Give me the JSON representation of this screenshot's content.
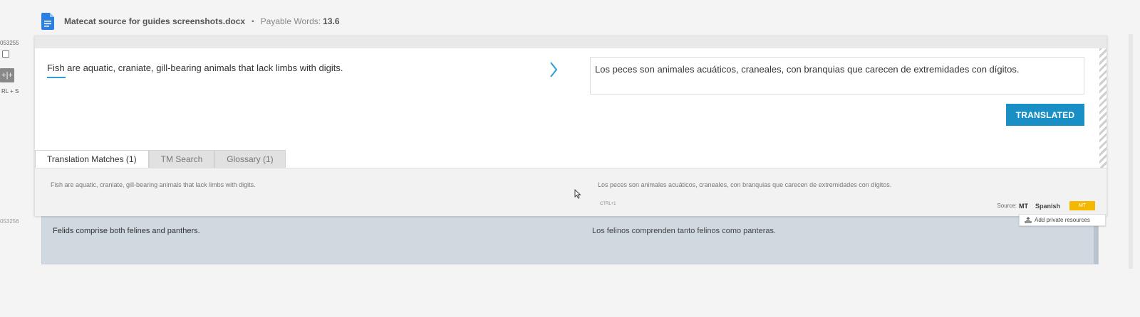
{
  "header": {
    "file_name": "Matecat source for guides screenshots.docx",
    "separator": "▪",
    "payable_label": "Payable Words:",
    "payable_value": "13.6"
  },
  "segments": {
    "active": {
      "id": "053255",
      "shortcut": "RL + S",
      "split_label": "+|+",
      "source": "Fish are aquatic, craniate, gill-bearing animals that lack limbs with digits.",
      "target": "Los peces son animales acuáticos, craneales, con branquias que carecen de extremidades con dígitos.",
      "status_button": "TRANSLATED"
    },
    "next": {
      "id": "053256",
      "source": "Felids comprise both felines and panthers.",
      "target": "Los felinos comprenden tanto felinos como panteras."
    }
  },
  "tabs": [
    {
      "label": "Translation Matches (1)",
      "active": true
    },
    {
      "label": "TM Search",
      "active": false
    },
    {
      "label": "Glossary (1)",
      "active": false
    }
  ],
  "match": {
    "source": "Fish are aquatic, craniate, gill-bearing animals that lack limbs with digits.",
    "target": "Los peces son animales acuáticos, craneales, con branquias que carecen de extremidades con dígitos.",
    "shortcut": "CTRL+1",
    "source_label": "Source:",
    "source_value": "MT",
    "language": "Spanish",
    "badge": "MT"
  },
  "tooltip": {
    "add_private": "Add private resources"
  },
  "colors": {
    "accent": "#1a8fc6",
    "badge": "#f5b800",
    "next_segment_bg": "#d0d8e0"
  }
}
